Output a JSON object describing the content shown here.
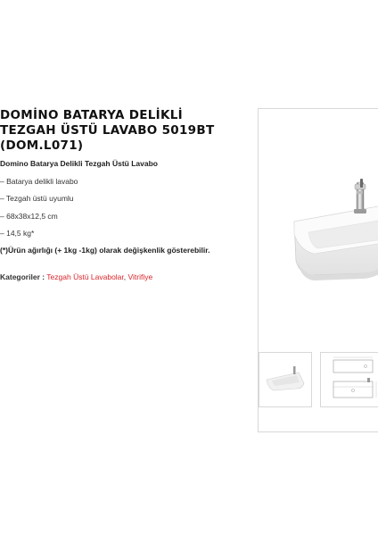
{
  "product": {
    "title_line1": "DOMİNO BATARYA DELİKLİ",
    "title_line2": "TEZGAH ÜSTÜ LAVABO 5019BT",
    "title_line3": "(DOM.L071)",
    "subtitle": "Domino Batarya Delikli Tezgah Üstü Lavabo",
    "specs": [
      "– Batarya delikli lavabo",
      "– Tezgah üstü uyumlu",
      "– 68x38x12,5 cm",
      "– 14,5 kg*"
    ],
    "note": "(*)Ürün ağırlığı (+ 1kg -1kg) olarak değişkenlik gösterebilir.",
    "categories_label": "Kategoriler :",
    "categories": [
      "Tezgah Üstü Lavabolar",
      "Vitrifiye"
    ],
    "categories_separator": ", "
  },
  "gallery": {
    "main_image": "sink-with-faucet-photo",
    "thumbnails": [
      "sink-thumbnail",
      "technical-drawing-thumbnail"
    ]
  },
  "colors": {
    "link": "#d9262c",
    "border": "#d8d8d8"
  }
}
